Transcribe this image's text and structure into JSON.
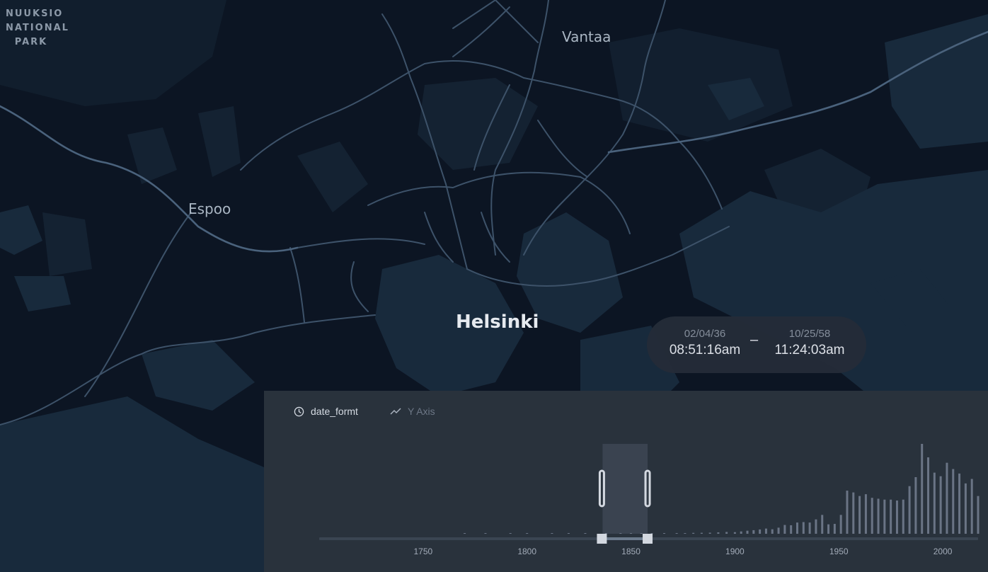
{
  "map": {
    "places": {
      "park": [
        "NUUKSIO",
        "NATIONAL",
        "PARK"
      ],
      "vantaa": "Vantaa",
      "espoo": "Espoo",
      "helsinki": "Helsinki"
    },
    "colors": {
      "background": "#0c1523",
      "land_dark": "#101c2a",
      "land_light": "#17283a",
      "road": "#3d5269",
      "road_major": "#4a627c"
    }
  },
  "time_range": {
    "start_date": "02/04/36",
    "start_time": "08:51:16am",
    "separator": "–",
    "end_date": "10/25/58",
    "end_time": "11:24:03am"
  },
  "time_widget": {
    "field_label": "date_formt",
    "field_icon": "clock-icon",
    "y_axis_label": "Y Axis",
    "y_axis_icon": "line-chart-icon",
    "colors": {
      "panel": "#29323c",
      "bar": "#6a7485",
      "track": "#3a4552",
      "selection": "#3a4350",
      "handle": "#d3d8e0"
    }
  },
  "chart_data": {
    "type": "bar",
    "x_ticks": [
      1750,
      1800,
      1850,
      1900,
      1950,
      2000
    ],
    "xlim": [
      1700,
      2017
    ],
    "selection": [
      1836,
      1858
    ],
    "bars": [
      [
        1770,
        0.4
      ],
      [
        1780,
        0.3
      ],
      [
        1792,
        0.3
      ],
      [
        1800,
        0.4
      ],
      [
        1812,
        0.2
      ],
      [
        1820,
        0.3
      ],
      [
        1828,
        0.4
      ],
      [
        1838,
        0.3
      ],
      [
        1845,
        0.2
      ],
      [
        1850,
        0.8
      ],
      [
        1855,
        0.5
      ],
      [
        1860,
        0.7
      ],
      [
        1866,
        0.5
      ],
      [
        1872,
        0.8
      ],
      [
        1876,
        0.7
      ],
      [
        1880,
        1.0
      ],
      [
        1884,
        1.1
      ],
      [
        1888,
        1.2
      ],
      [
        1892,
        1.6
      ],
      [
        1896,
        2.0
      ],
      [
        1900,
        1.8
      ],
      [
        1903,
        2.6
      ],
      [
        1906,
        3.4
      ],
      [
        1909,
        4.0
      ],
      [
        1912,
        4.8
      ],
      [
        1915,
        5.8
      ],
      [
        1918,
        5.0
      ],
      [
        1921,
        6.8
      ],
      [
        1924,
        9.8
      ],
      [
        1927,
        9.5
      ],
      [
        1930,
        12.5
      ],
      [
        1933,
        13.0
      ],
      [
        1936,
        12.5
      ],
      [
        1939,
        16.0
      ],
      [
        1942,
        21.0
      ],
      [
        1945,
        10.5
      ],
      [
        1948,
        11.0
      ],
      [
        1951,
        21.0
      ],
      [
        1954,
        48.0
      ],
      [
        1957,
        46.0
      ],
      [
        1960,
        42.0
      ],
      [
        1963,
        44.0
      ],
      [
        1966,
        40.0
      ],
      [
        1969,
        39.0
      ],
      [
        1972,
        38.0
      ],
      [
        1975,
        38.0
      ],
      [
        1978,
        37.0
      ],
      [
        1981,
        38.0
      ],
      [
        1984,
        53.0
      ],
      [
        1987,
        63.0
      ],
      [
        1990,
        100.0
      ],
      [
        1993,
        85.0
      ],
      [
        1996,
        68.0
      ],
      [
        1999,
        64.0
      ],
      [
        2002,
        79.0
      ],
      [
        2005,
        72.0
      ],
      [
        2008,
        67.0
      ],
      [
        2011,
        56.0
      ],
      [
        2014,
        61.0
      ],
      [
        2017,
        42.0
      ]
    ]
  }
}
